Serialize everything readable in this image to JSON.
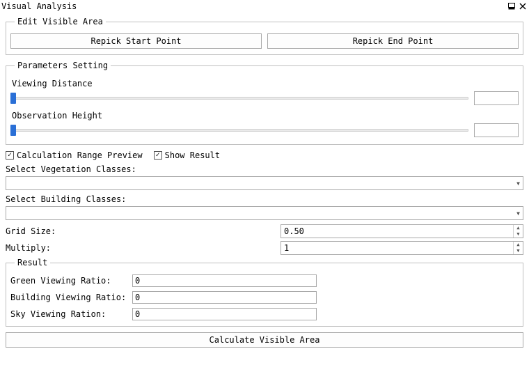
{
  "title": "Visual Analysis",
  "edit_area": {
    "legend": "Edit Visible Area",
    "repick_start": "Repick Start Point",
    "repick_end": "Repick End Point"
  },
  "params": {
    "legend": "Parameters Setting",
    "viewing_distance_label": "Viewing Distance",
    "viewing_distance_value": "",
    "observation_height_label": "Observation Height",
    "observation_height_value": ""
  },
  "checks": {
    "calc_range_preview": "Calculation Range Preview",
    "calc_range_preview_checked": true,
    "show_result": "Show Result",
    "show_result_checked": true
  },
  "selects": {
    "veg_label": "Select Vegetation Classes:",
    "veg_value": "",
    "bld_label": "Select Building Classes:",
    "bld_value": ""
  },
  "grid": {
    "grid_size_label": "Grid Size:",
    "grid_size_value": "0.50",
    "multiply_label": "Multiply:",
    "multiply_value": "1"
  },
  "result": {
    "legend": "Result",
    "green_label": "Green Viewing Ratio:",
    "green_value": "0",
    "building_label": "Building Viewing Ratio:",
    "building_value": "0",
    "sky_label": "Sky Viewing Ration:",
    "sky_value": "0"
  },
  "calculate": "Calculate Visible Area"
}
